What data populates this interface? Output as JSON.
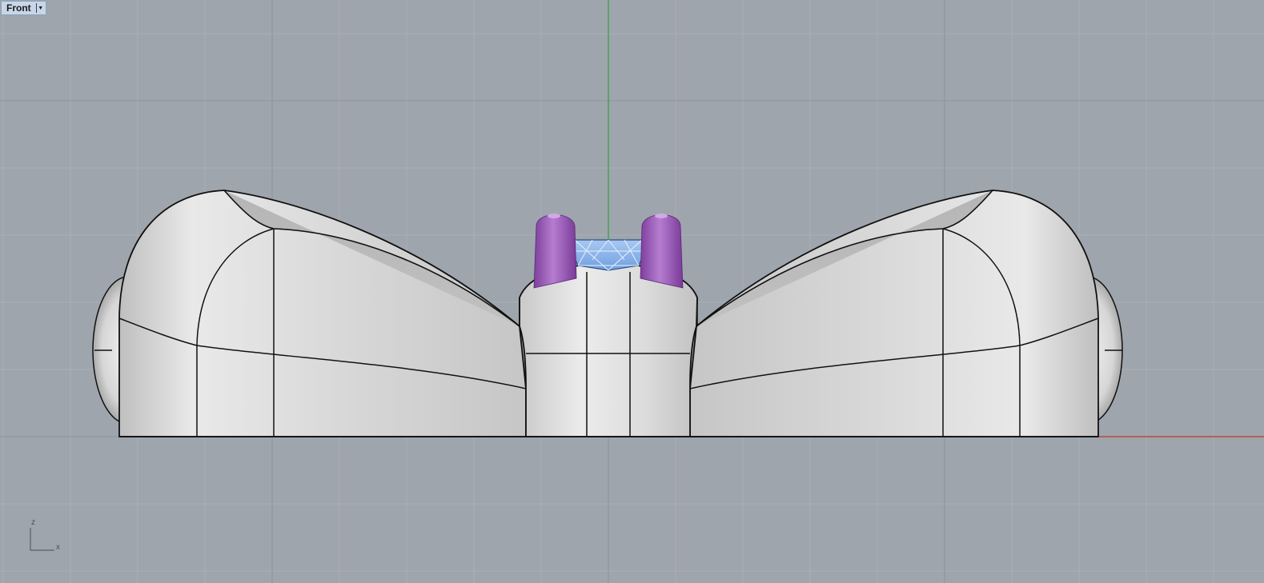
{
  "viewport": {
    "name": "Front",
    "colors": {
      "background": "#9ea5ad",
      "grid_minor": "#a9b0b8",
      "grid_major": "#8c939b",
      "axis_z": "#2fa23a",
      "axis_x": "#c0392b",
      "body_fill": "#dedede",
      "body_edge": "#111111",
      "pin_fill": "#9a5bb8",
      "gem_fill": "#8cb3ea",
      "gem_edge": "#e8f1ff"
    }
  },
  "axis_indicator": {
    "z_label": "z",
    "x_label": "x"
  },
  "tab_arrow_icon": "chevron-down-icon"
}
